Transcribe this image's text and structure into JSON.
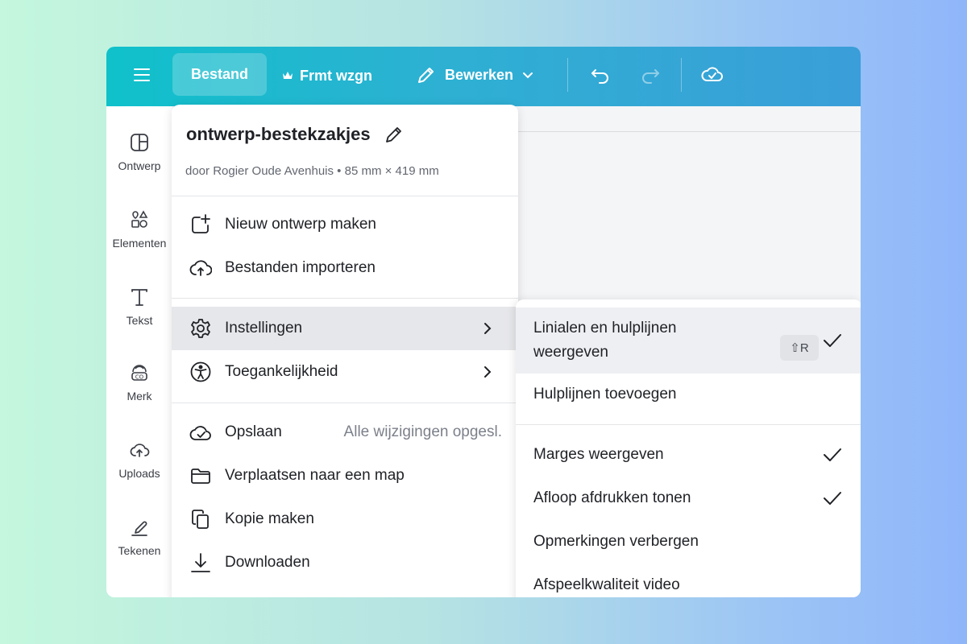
{
  "colors": {
    "topbar_start": "#0fc1ca",
    "topbar_end": "#3a9ed8",
    "highlight": "#e6e7ea",
    "text": "#1f2126",
    "muted": "#7c808a"
  },
  "topbar": {
    "menu_icon": "hamburger-icon",
    "file_label": "Bestand",
    "resize_label": "Frmt wzgn",
    "edit_label": "Bewerken",
    "undo_icon": "undo-icon",
    "redo_icon": "redo-icon",
    "save_status_icon": "cloud-check-icon"
  },
  "sidebar": {
    "items": [
      {
        "label": "Ontwerp",
        "icon": "layout-icon"
      },
      {
        "label": "Elementen",
        "icon": "shapes-icon"
      },
      {
        "label": "Tekst",
        "icon": "text-icon"
      },
      {
        "label": "Merk",
        "icon": "brand-icon"
      },
      {
        "label": "Uploads",
        "icon": "upload-cloud-icon"
      },
      {
        "label": "Tekenen",
        "icon": "draw-icon"
      }
    ]
  },
  "file_menu": {
    "title": "ontwerp-bestekzakjes",
    "subtitle": "door Rogier Oude Avenhuis • 85 mm × 419 mm",
    "items": [
      {
        "label": "Nieuw ontwerp maken",
        "icon": "new-design-icon"
      },
      {
        "label": "Bestanden importeren",
        "icon": "import-cloud-icon"
      },
      {
        "label": "Instellingen",
        "icon": "gear-icon",
        "submenu": true,
        "active": true
      },
      {
        "label": "Toegankelijkheid",
        "icon": "accessibility-icon",
        "submenu": true
      },
      {
        "label": "Opslaan",
        "icon": "save-cloud-icon",
        "status": "Alle wijzigingen opgesl."
      },
      {
        "label": "Verplaatsen naar een map",
        "icon": "folder-icon"
      },
      {
        "label": "Kopie maken",
        "icon": "copy-icon"
      },
      {
        "label": "Downloaden",
        "icon": "download-icon"
      }
    ]
  },
  "settings_menu": {
    "items": [
      {
        "label": "Linialen en hulplijnen weergeven",
        "shortcut": "⇧R",
        "checked": true,
        "highlighted": true
      },
      {
        "label": "Hulplijnen toevoegen",
        "checked": false
      },
      {
        "label": "Marges weergeven",
        "checked": true
      },
      {
        "label": "Afloop afdrukken tonen",
        "checked": true
      },
      {
        "label": "Opmerkingen verbergen",
        "checked": false
      },
      {
        "label": "Afspeelkwaliteit video",
        "checked": false
      }
    ]
  }
}
